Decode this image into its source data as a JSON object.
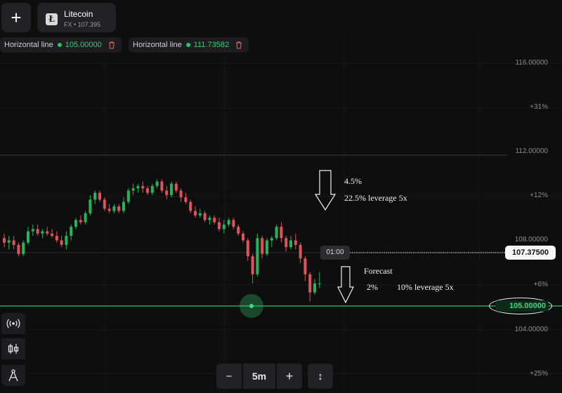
{
  "asset": {
    "name": "Litecoin",
    "subtitle": "FX • 107.395"
  },
  "horizontal_lines": [
    {
      "label": "Horizontal line",
      "value": "105.00000"
    },
    {
      "label": "Horizontal line",
      "value": "111.73582"
    }
  ],
  "y_axis_labels": [
    "116.00000",
    "+31%",
    "112.00000",
    "+12%",
    "108.00000",
    "+6%",
    "104.00000",
    "+25%"
  ],
  "current_price": "107.37500",
  "candle_timer": "01:00",
  "active_line_value": "105.00000",
  "annotations": {
    "upper_pct": "4.5%",
    "upper_leverage": "22.5% leverage 5x",
    "forecast": "Forecast",
    "lower_pct": "2%",
    "lower_leverage": "10% leverage 5x"
  },
  "controls": {
    "minus": "−",
    "timeframe": "5m",
    "plus": "+",
    "axis_toggle": "↕"
  },
  "colors": {
    "up": "#27b35a",
    "down": "#e0525c",
    "line": "#2ec27a",
    "background": "#0e0e0f"
  },
  "icons": [
    "plus-icon",
    "litecoin-icon",
    "trash-icon",
    "broadcast-icon",
    "candles-icon",
    "drawing-icon",
    "pencil-icon"
  ],
  "chart_data": {
    "type": "candlestick",
    "ylim": [
      102.0,
      117.5
    ],
    "candles": [
      [
        109.4,
        109.6,
        109.0,
        109.2
      ],
      [
        109.2,
        109.5,
        108.9,
        109.3
      ],
      [
        109.3,
        109.5,
        108.9,
        109.1
      ],
      [
        109.1,
        109.2,
        108.6,
        108.7
      ],
      [
        108.7,
        109.3,
        108.6,
        109.2
      ],
      [
        109.2,
        109.9,
        109.1,
        109.7
      ],
      [
        109.7,
        110.0,
        109.5,
        109.8
      ],
      [
        109.8,
        110.0,
        109.5,
        109.6
      ],
      [
        109.6,
        109.8,
        109.4,
        109.7
      ],
      [
        109.7,
        109.9,
        109.5,
        109.6
      ],
      [
        109.6,
        109.8,
        109.4,
        109.5
      ],
      [
        109.5,
        109.7,
        109.2,
        109.3
      ],
      [
        109.3,
        109.5,
        109.0,
        109.1
      ],
      [
        109.1,
        109.7,
        108.9,
        109.5
      ],
      [
        109.5,
        110.0,
        109.3,
        109.9
      ],
      [
        109.9,
        110.3,
        109.8,
        110.2
      ],
      [
        110.2,
        110.4,
        110.0,
        110.1
      ],
      [
        110.1,
        110.6,
        110.0,
        110.5
      ],
      [
        110.5,
        111.3,
        110.4,
        111.1
      ],
      [
        111.1,
        111.5,
        110.9,
        111.4
      ],
      [
        111.4,
        111.5,
        111.0,
        111.1
      ],
      [
        111.1,
        111.2,
        110.6,
        110.7
      ],
      [
        110.7,
        110.9,
        110.5,
        110.6
      ],
      [
        110.6,
        110.9,
        110.5,
        110.8
      ],
      [
        110.8,
        110.9,
        110.5,
        110.6
      ],
      [
        110.6,
        111.2,
        110.5,
        111.0
      ],
      [
        111.0,
        111.6,
        110.9,
        111.5
      ],
      [
        111.5,
        111.8,
        111.3,
        111.6
      ],
      [
        111.6,
        111.8,
        111.4,
        111.7
      ],
      [
        111.7,
        111.9,
        111.4,
        111.6
      ],
      [
        111.6,
        111.7,
        111.3,
        111.4
      ],
      [
        111.4,
        111.8,
        111.3,
        111.7
      ],
      [
        111.7,
        112.0,
        111.6,
        111.9
      ],
      [
        111.9,
        112.0,
        111.4,
        111.5
      ],
      [
        111.5,
        111.7,
        111.1,
        111.3
      ],
      [
        111.3,
        111.9,
        111.2,
        111.8
      ],
      [
        111.8,
        111.9,
        111.4,
        111.5
      ],
      [
        111.5,
        111.6,
        111.0,
        111.2
      ],
      [
        111.2,
        111.4,
        110.9,
        111.0
      ],
      [
        111.0,
        111.1,
        110.5,
        110.6
      ],
      [
        110.6,
        110.8,
        110.3,
        110.4
      ],
      [
        110.4,
        110.7,
        110.3,
        110.5
      ],
      [
        110.5,
        110.6,
        110.1,
        110.2
      ],
      [
        110.2,
        110.4,
        110.0,
        110.3
      ],
      [
        110.3,
        110.4,
        110.0,
        110.1
      ],
      [
        110.1,
        110.3,
        109.7,
        109.8
      ],
      [
        109.8,
        110.2,
        109.6,
        110.0
      ],
      [
        110.0,
        110.3,
        109.9,
        110.2
      ],
      [
        110.2,
        110.3,
        109.8,
        109.9
      ],
      [
        109.9,
        110.0,
        109.5,
        109.6
      ],
      [
        109.6,
        109.7,
        109.2,
        109.3
      ],
      [
        109.3,
        109.4,
        108.4,
        108.6
      ],
      [
        108.6,
        108.7,
        107.4,
        107.8
      ],
      [
        107.8,
        109.6,
        107.7,
        109.4
      ],
      [
        109.4,
        109.5,
        108.5,
        108.7
      ],
      [
        108.7,
        109.4,
        108.6,
        109.3
      ],
      [
        109.3,
        109.5,
        109.0,
        109.4
      ],
      [
        109.4,
        110.0,
        109.3,
        109.9
      ],
      [
        109.9,
        110.1,
        109.2,
        109.4
      ],
      [
        109.4,
        109.5,
        108.8,
        109.0
      ],
      [
        109.0,
        109.5,
        108.9,
        109.3
      ],
      [
        109.3,
        109.6,
        108.9,
        109.1
      ],
      [
        109.1,
        109.2,
        108.3,
        108.5
      ],
      [
        108.5,
        108.6,
        107.5,
        107.8
      ],
      [
        107.8,
        107.9,
        106.6,
        107.0
      ],
      [
        107.0,
        107.6,
        106.9,
        107.4
      ],
      [
        107.4,
        107.9,
        107.2,
        107.4
      ]
    ]
  }
}
